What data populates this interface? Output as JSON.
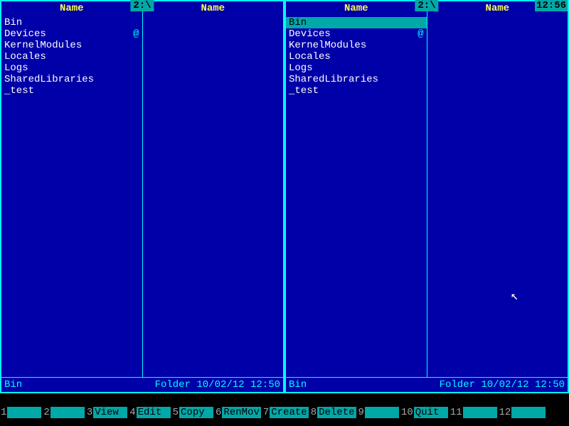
{
  "clock": "12:56",
  "panels": [
    {
      "path": "2:\\",
      "columns": [
        "Name",
        "Name"
      ],
      "files": [
        {
          "name": "Bin",
          "mark": ""
        },
        {
          "name": "Devices",
          "mark": "@"
        },
        {
          "name": "KernelModules",
          "mark": ""
        },
        {
          "name": "Locales",
          "mark": ""
        },
        {
          "name": "Logs",
          "mark": ""
        },
        {
          "name": "SharedLibraries",
          "mark": ""
        },
        {
          "name": "_test",
          "mark": ""
        }
      ],
      "selected_index": -1,
      "status": {
        "name": "Bin",
        "info": "Folder 10/02/12 12:50"
      }
    },
    {
      "path": "2:\\",
      "columns": [
        "Name",
        "Name"
      ],
      "files": [
        {
          "name": "Bin",
          "mark": ""
        },
        {
          "name": "Devices",
          "mark": "@"
        },
        {
          "name": "KernelModules",
          "mark": ""
        },
        {
          "name": "Locales",
          "mark": ""
        },
        {
          "name": "Logs",
          "mark": ""
        },
        {
          "name": "SharedLibraries",
          "mark": ""
        },
        {
          "name": "_test",
          "mark": ""
        }
      ],
      "selected_index": 0,
      "status": {
        "name": "Bin",
        "info": "Folder 10/02/12 12:50"
      }
    }
  ],
  "fkeys": [
    {
      "num": "1",
      "label": ""
    },
    {
      "num": "2",
      "label": ""
    },
    {
      "num": "3",
      "label": "View"
    },
    {
      "num": "4",
      "label": "Edit"
    },
    {
      "num": "5",
      "label": "Copy"
    },
    {
      "num": "6",
      "label": "RenMov"
    },
    {
      "num": "7",
      "label": "Create"
    },
    {
      "num": "8",
      "label": "Delete"
    },
    {
      "num": "9",
      "label": ""
    },
    {
      "num": "10",
      "label": "Quit"
    },
    {
      "num": "11",
      "label": ""
    },
    {
      "num": "12",
      "label": ""
    }
  ]
}
